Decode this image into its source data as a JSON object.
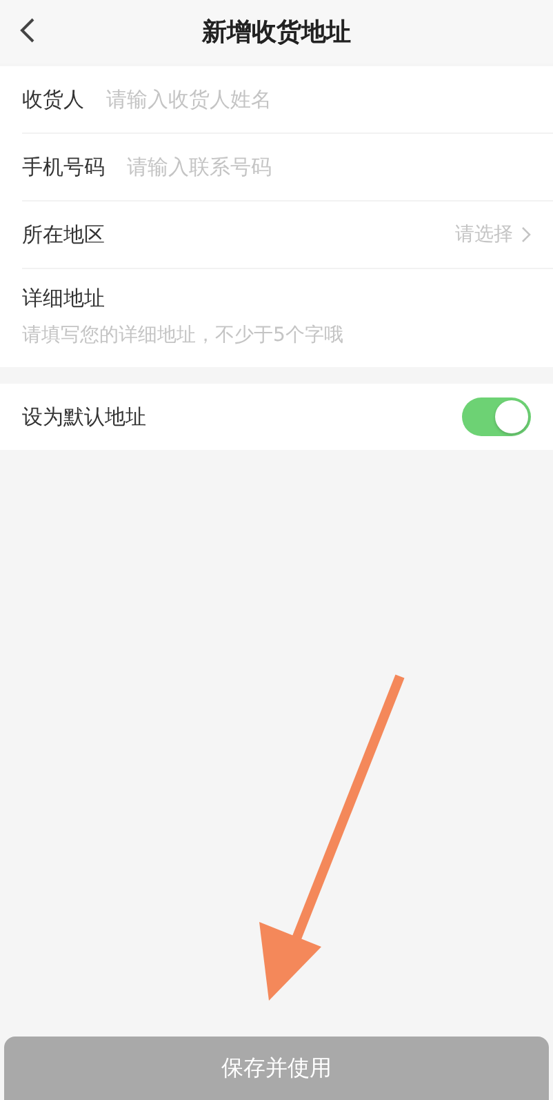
{
  "header": {
    "title": "新增收货地址"
  },
  "fields": [
    {
      "kind": "input",
      "label": "收货人",
      "placeholder": "请输入收货人姓名"
    },
    {
      "kind": "input",
      "label": "手机号码",
      "placeholder": "请输入联系号码"
    },
    {
      "kind": "select",
      "label": "所在地区",
      "placeholder": "请选择"
    },
    {
      "kind": "textarea",
      "label": "详细地址",
      "placeholder": "请填写您的详细地址，不少于5个字哦"
    }
  ],
  "default_address": {
    "label": "设为默认地址",
    "on": true
  },
  "save_button": {
    "label": "保存并使用",
    "disabled": true
  }
}
